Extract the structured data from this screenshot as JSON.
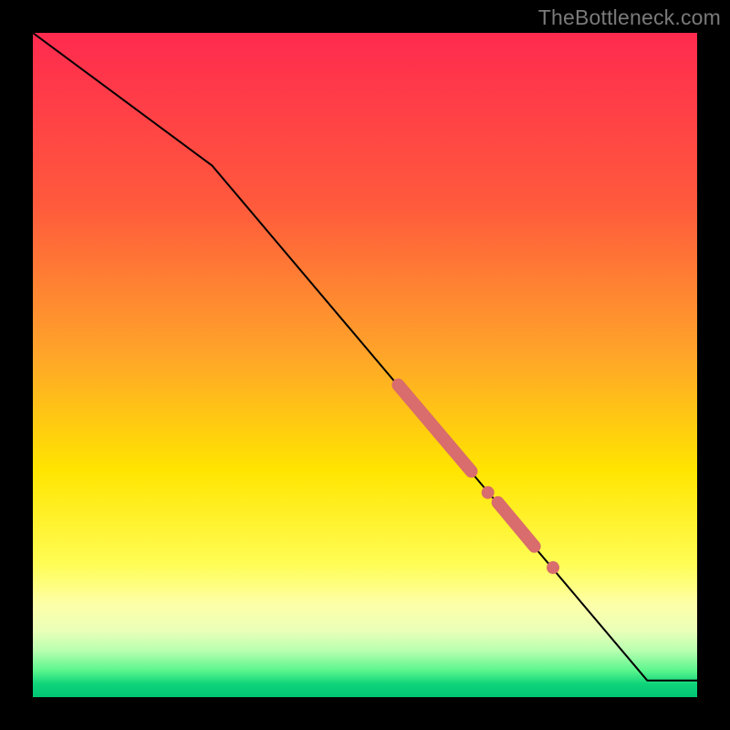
{
  "watermark": "TheBottleneck.com",
  "colors": {
    "frame": "#000000",
    "line": "#000000",
    "marker": "#d96c6c",
    "gradient_stops": [
      {
        "pct": 0,
        "color": "#ff2a4f"
      },
      {
        "pct": 26,
        "color": "#ff5a3c"
      },
      {
        "pct": 48,
        "color": "#ffa32a"
      },
      {
        "pct": 66,
        "color": "#ffe500"
      },
      {
        "pct": 80,
        "color": "#fffd55"
      },
      {
        "pct": 86,
        "color": "#fdffa8"
      },
      {
        "pct": 90,
        "color": "#eaffb8"
      },
      {
        "pct": 93,
        "color": "#b8ffb0"
      },
      {
        "pct": 96,
        "color": "#5bf58e"
      },
      {
        "pct": 98,
        "color": "#0fd47a"
      },
      {
        "pct": 100,
        "color": "#00c474"
      }
    ]
  },
  "chart_data": {
    "type": "line",
    "title": "",
    "xlabel": "",
    "ylabel": "",
    "xlim": [
      0,
      100
    ],
    "ylim": [
      0,
      100
    ],
    "grid": false,
    "legend": false,
    "series": [
      {
        "name": "curve",
        "x": [
          0,
          27,
          92.5,
          100
        ],
        "y": [
          100,
          80,
          2.5,
          2.5
        ]
      }
    ],
    "markers": [
      {
        "name": "highlight-segment-1",
        "kind": "segment",
        "x1": 55,
        "y1": 47,
        "x2": 66,
        "y2": 34
      },
      {
        "name": "highlight-dot-1",
        "kind": "dot",
        "x": 68.5,
        "y": 30.8
      },
      {
        "name": "highlight-segment-2",
        "kind": "segment",
        "x1": 70,
        "y1": 29.3,
        "x2": 75.5,
        "y2": 22.7
      },
      {
        "name": "highlight-dot-2",
        "kind": "dot",
        "x": 78.3,
        "y": 19.5
      }
    ]
  }
}
